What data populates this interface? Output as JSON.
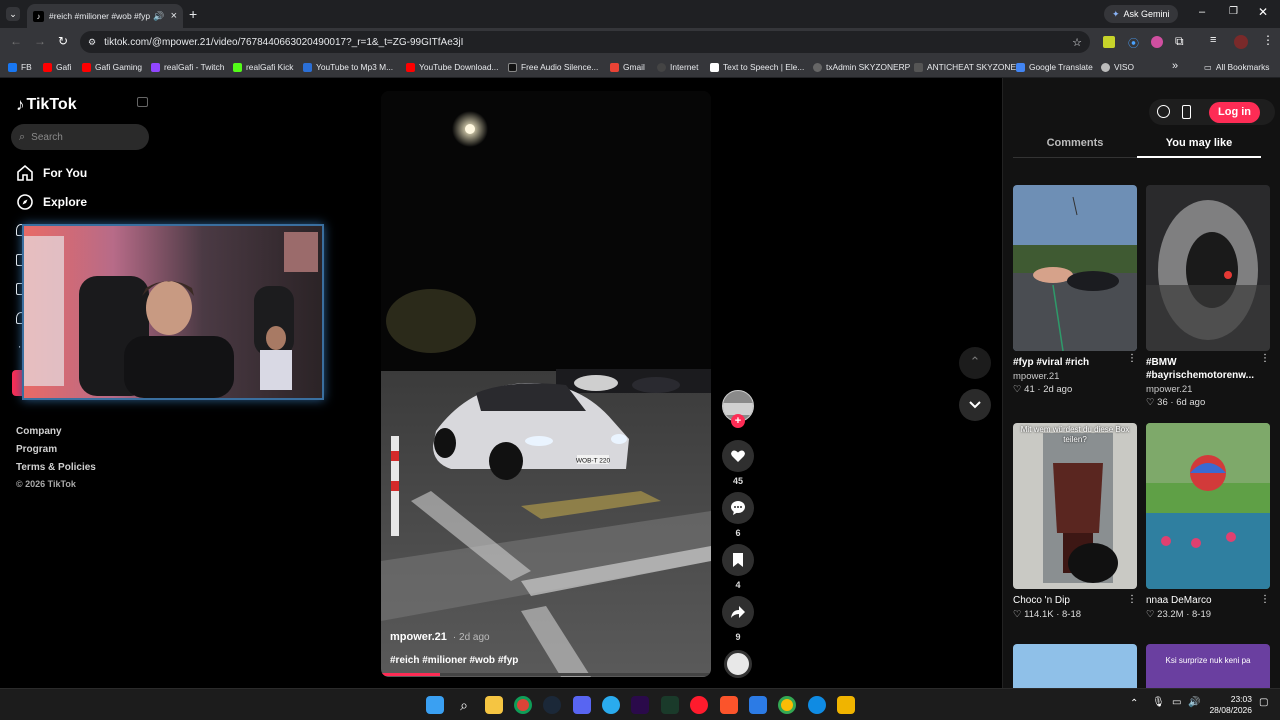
{
  "browser": {
    "tab_title": "#reich #milioner #wob #fyp",
    "ask_gemini": "Ask Gemini",
    "url": "tiktok.com/@mpower.21/video/7678440663020490017?_r=1&_t=ZG-99GITfAe3jI",
    "bookmarks": [
      "FB",
      "Gafi",
      "Gafi Gaming",
      "realGafi - Twitch",
      "realGafi Kick",
      "YouTube to Mp3 M...",
      "YouTube Download...",
      "Free Audio Silence...",
      "Gmail",
      "Internet",
      "Text to Speech | Ele...",
      "txAdmin SKYZONERP",
      "ANTICHEAT SKYZONE",
      "Google Translate",
      "VISO"
    ],
    "all_bookmarks": "All Bookmarks"
  },
  "sidebar": {
    "logo": "TikTok",
    "search_placeholder": "Search",
    "nav": [
      "For You",
      "Explore"
    ],
    "footer": [
      "Company",
      "Program",
      "Terms & Policies",
      "© 2026 TikTok"
    ]
  },
  "video": {
    "author": "mpower.21",
    "age": "· 2d ago",
    "caption": "#reich #milioner #wob #fyp",
    "plate": "WOB-T 220",
    "likes": "45",
    "comments": "6",
    "saves": "4",
    "shares": "9"
  },
  "right": {
    "login": "Log in",
    "tabs": [
      "Comments",
      "You may like"
    ],
    "active_tab": "You may like",
    "cards": [
      {
        "title": "#fyp #viral #rich",
        "user": "mpower.21",
        "likes": "41",
        "age": "2d ago"
      },
      {
        "title": "#BMW #bayrischemotorenw...",
        "user": "mpower.21",
        "likes": "36",
        "age": "6d ago"
      },
      {
        "title": "Choco 'n Dip",
        "overlay": "Mit wem würdest du diese Box teilen?",
        "likes": "114.1K",
        "age": "8-18"
      },
      {
        "title": "nnaa DeMarco",
        "likes": "23.2M",
        "age": "8-19"
      }
    ],
    "bottom_card_overlay": "Ksi surprize nuk keni pa"
  },
  "taskbar": {
    "time": "23:03",
    "date": "28/08/2026"
  },
  "colors": {
    "accent": "#fe2c55",
    "chrome_dark": "#35363a",
    "panel": "#121212"
  }
}
